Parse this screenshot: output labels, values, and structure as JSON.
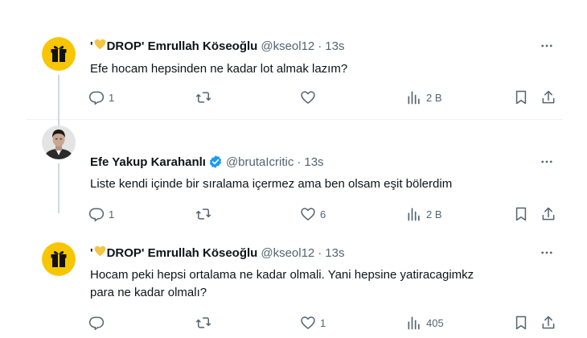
{
  "tweets": [
    {
      "display_name_prefix": "'",
      "display_name_main": "DROP' Emrullah Köseoğlu",
      "handle": "@kseol12",
      "separator": "·",
      "time": "13s",
      "text_lines": [
        "Efe hocam hepsinden ne kadar lot almak lazım?"
      ],
      "replies": "1",
      "reposts": "",
      "likes": "",
      "views": "2 B"
    },
    {
      "display_name": "Efe Yakup Karahanlı",
      "handle": "@brutaIcritic",
      "separator": "·",
      "time": "13s",
      "text_lines": [
        "Liste kendi içinde bir sıralama içermez ama ben olsam eşit bölerdim"
      ],
      "replies": "1",
      "reposts": "",
      "likes": "6",
      "views": "2 B"
    },
    {
      "display_name_prefix": "'",
      "display_name_main": "DROP' Emrullah Köseoğlu",
      "handle": "@kseol12",
      "separator": "·",
      "time": "13s",
      "text_lines": [
        "Hocam peki hepsi ortalama ne kadar olmali. Yani hepsine yatiracagimkz",
        "para ne kadar olmalı?"
      ],
      "replies": "",
      "reposts": "",
      "likes": "1",
      "views": "405"
    }
  ],
  "colors": {
    "text_primary": "#0f1419",
    "text_secondary": "#536471",
    "verified_blue": "#1d9bf0",
    "drop_avatar_yellow": "#f7c600",
    "heart_emoji": "#f4c542",
    "thread_line": "#cfd9de"
  },
  "icons": {
    "reply": "reply-icon",
    "repost": "repost-icon",
    "like": "like-icon",
    "views": "views-icon",
    "bookmark": "bookmark-icon",
    "share": "share-icon",
    "more": "more-icon",
    "verified": "verified-badge-icon"
  }
}
